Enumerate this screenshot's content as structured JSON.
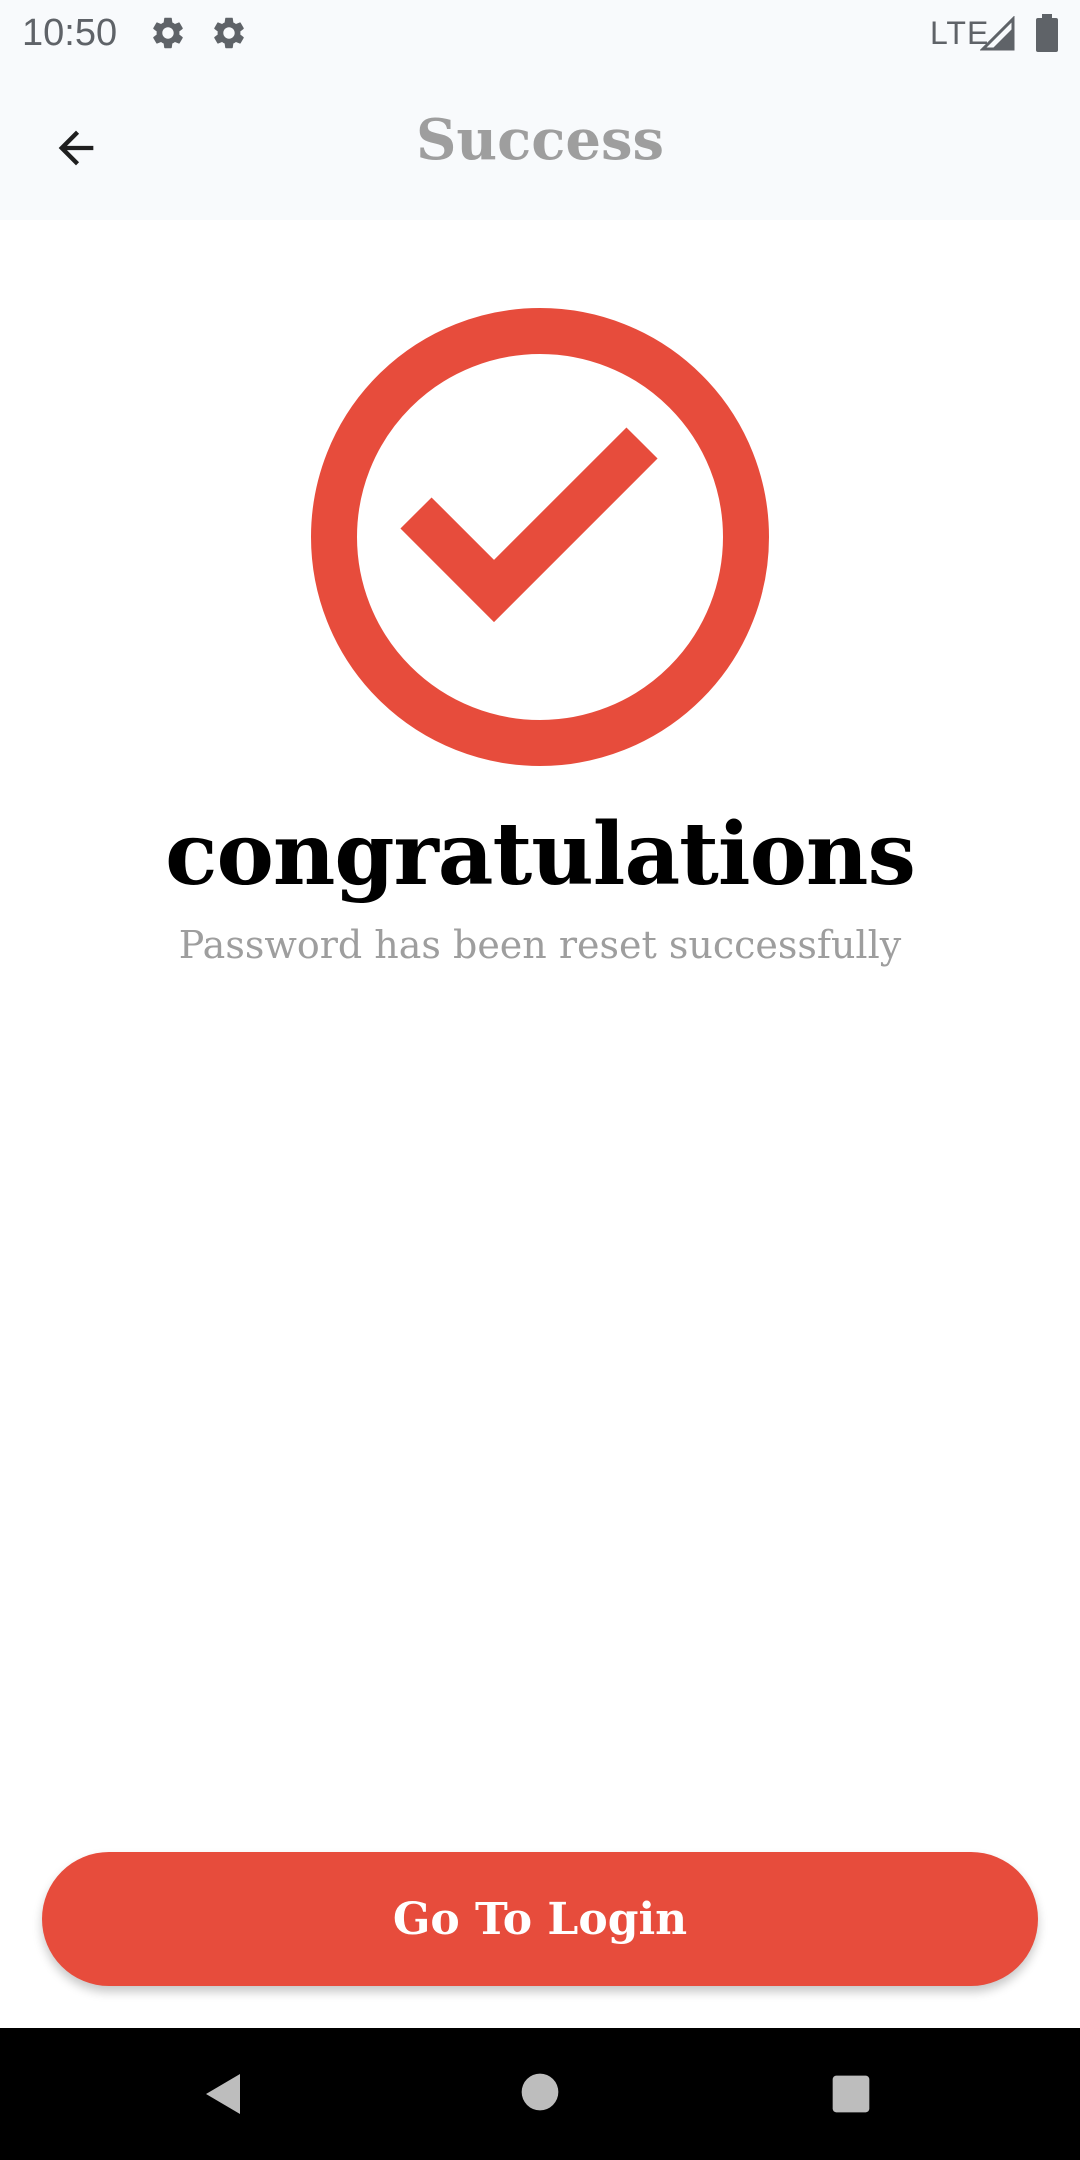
{
  "status_bar": {
    "time": "10:50",
    "network": "LTE"
  },
  "app_bar": {
    "title": "Success",
    "back_icon": "arrow-back-icon"
  },
  "content": {
    "icon": "check-circle-icon",
    "headline": "congratulations",
    "message": "Password has been reset successfully"
  },
  "actions": {
    "login_label": "Go To Login"
  },
  "colors": {
    "accent": "#e74c3c",
    "title_gray": "#9e9e9e",
    "bar_bg": "#f8fafc"
  }
}
